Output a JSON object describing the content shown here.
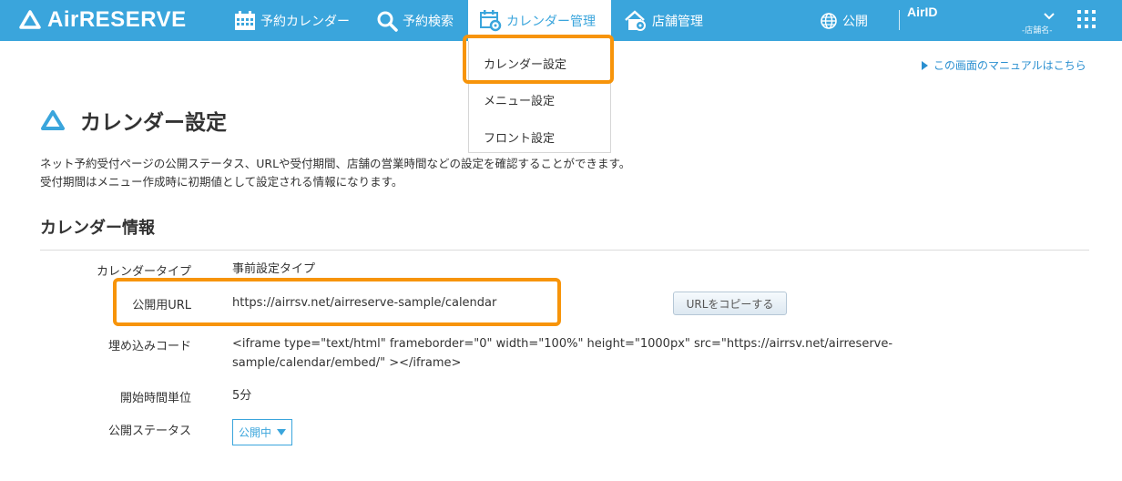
{
  "app": {
    "logo": "AirRESERVE"
  },
  "nav": {
    "calendar": "予約カレンダー",
    "search": "予約検索",
    "calendar_mgmt": "カレンダー管理",
    "store_mgmt": "店舗管理",
    "publish": "公開",
    "airid": "AirID",
    "shop_name": "-店舗名-"
  },
  "dropdown": {
    "items": [
      "カレンダー設定",
      "メニュー設定",
      "フロント設定"
    ]
  },
  "manual_link": "この画面のマニュアルはこちら",
  "page": {
    "title": "カレンダー設定",
    "desc_line1": "ネット予約受付ページの公開ステータス、URLや受付期間、店舗の営業時間などの設定を確認することができます。",
    "desc_line2": "受付期間はメニュー作成時に初期値として設定される情報になります。",
    "section_title": "カレンダー情報"
  },
  "info": {
    "type_label": "カレンダータイプ",
    "type_value": "事前設定タイプ",
    "url_label": "公開用URL",
    "url_value": "https://airrsv.net/airreserve-sample/calendar",
    "copy_button": "URLをコピーする",
    "embed_label": "埋め込みコード",
    "embed_line1": "<iframe type=\"text/html\" frameborder=\"0\" width=\"100%\" height=\"1000px\" src=\"https://airrsv.net/airreserve-",
    "embed_line2": "sample/calendar/embed/\" ></iframe>",
    "unit_label": "開始時間単位",
    "unit_value": "5分",
    "status_label": "公開ステータス",
    "status_value": "公開中"
  },
  "colors": {
    "header": "#3aa5dc",
    "highlight": "#f7940a",
    "link": "#2a8fd0"
  }
}
